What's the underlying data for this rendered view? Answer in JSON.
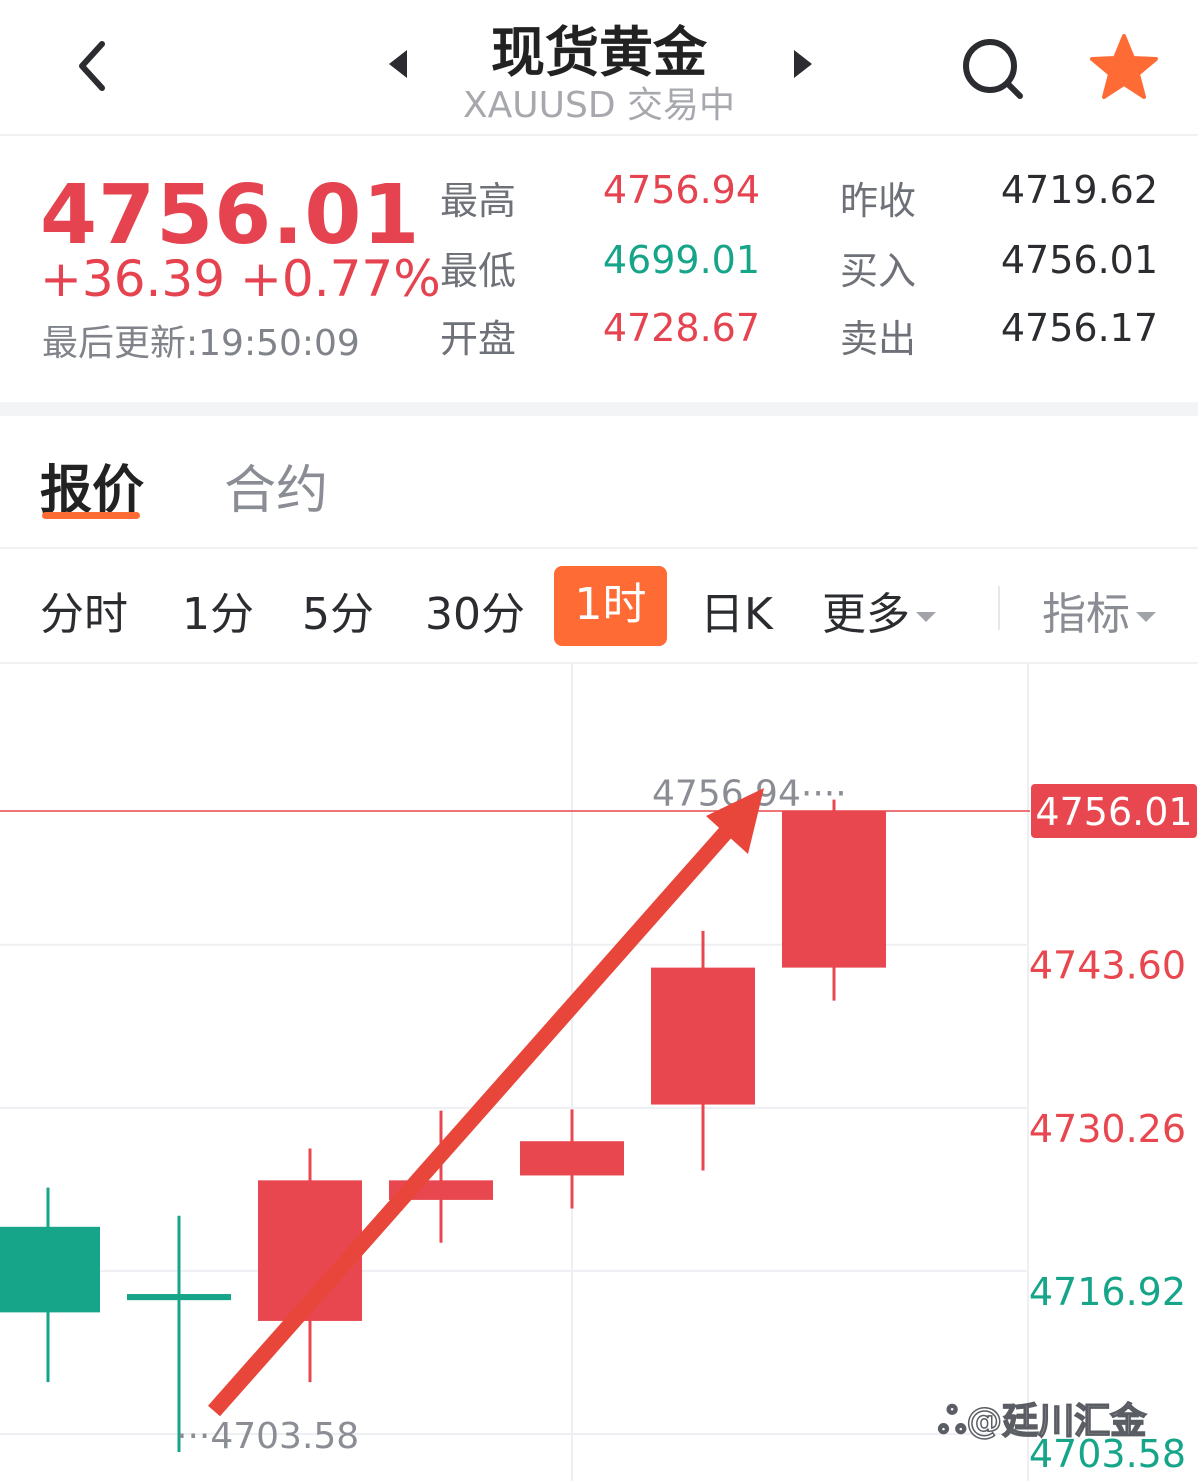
{
  "header": {
    "title": "现货黄金",
    "subtitle": "XAUUSD 交易中"
  },
  "quote": {
    "last_price": "4756.01",
    "change": "+36.39",
    "change_pct": "+0.77%",
    "last_update": "最后更新:19:50:09",
    "stats": [
      {
        "label": "最高",
        "value": "4756.94",
        "color": "#e5434f"
      },
      {
        "label": "最低",
        "value": "4699.01",
        "color": "#17a58a"
      },
      {
        "label": "开盘",
        "value": "4728.67",
        "color": "#e5434f"
      },
      {
        "label": "昨收",
        "value": "4719.62",
        "color": "#2a2c30"
      },
      {
        "label": "买入",
        "value": "4756.01",
        "color": "#2a2c30"
      },
      {
        "label": "卖出",
        "value": "4756.17",
        "color": "#2a2c30"
      }
    ]
  },
  "tabs": [
    {
      "label": "报价",
      "active": true
    },
    {
      "label": "合约",
      "active": false
    }
  ],
  "periods": [
    {
      "label": "分时",
      "active": false
    },
    {
      "label": "1分",
      "active": false
    },
    {
      "label": "5分",
      "active": false
    },
    {
      "label": "30分",
      "active": false
    },
    {
      "label": "1时",
      "active": true
    },
    {
      "label": "日K",
      "active": false
    },
    {
      "label": "更多",
      "active": false
    },
    {
      "label": "指标",
      "active": false
    }
  ],
  "colors": {
    "up": "#e8474f",
    "down": "#17a58a",
    "accent": "#ff6b35",
    "star": "#ff6b35"
  },
  "watermark": "@廷川汇金",
  "chart_data": {
    "type": "candlestick",
    "y_axis_labels": [
      "4756.01",
      "4743.60",
      "4730.26",
      "4716.92",
      "4703.58"
    ],
    "current_price": "4756.01",
    "high_marker": "4756.94",
    "low_marker": "4703.58",
    "ylim": [
      4703.58,
      4756.94
    ],
    "candles": [
      {
        "open": 4722.0,
        "high": 4725.2,
        "low": 4709.3,
        "close": 4715.0
      },
      {
        "open": 4716.5,
        "high": 4722.9,
        "low": 4703.58,
        "close": 4716.0
      },
      {
        "open": 4714.3,
        "high": 4728.4,
        "low": 4709.3,
        "close": 4725.8
      },
      {
        "open": 4724.2,
        "high": 4731.5,
        "low": 4720.7,
        "close": 4725.8
      },
      {
        "open": 4726.2,
        "high": 4731.6,
        "low": 4723.5,
        "close": 4729.0
      },
      {
        "open": 4732.0,
        "high": 4746.2,
        "low": 4726.6,
        "close": 4743.2
      },
      {
        "open": 4743.2,
        "high": 4756.94,
        "low": 4740.5,
        "close": 4756.01
      }
    ],
    "annotation": "upward arrow"
  }
}
